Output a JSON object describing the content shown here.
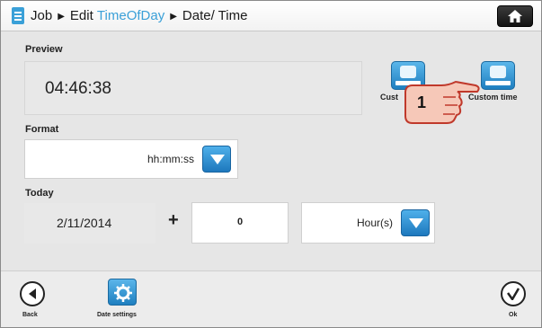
{
  "header": {
    "crumbs": [
      "Job",
      "Edit",
      "TimeOfDay",
      "Date/ Time"
    ],
    "accent_color": "#3aa0d8"
  },
  "preview": {
    "label": "Preview",
    "value": "04:46:38"
  },
  "modes": {
    "custom_format_label": "Cust",
    "custom_time_label": "Custom time"
  },
  "callout": {
    "number": "1"
  },
  "format": {
    "label": "Format",
    "value": "hh:mm:ss"
  },
  "today": {
    "label": "Today",
    "date": "2/11/2014",
    "plus": "+",
    "offset": "0",
    "unit": "Hour(s)"
  },
  "footer": {
    "back_label": "Back",
    "date_settings_label": "Date settings",
    "ok_label": "Ok"
  }
}
